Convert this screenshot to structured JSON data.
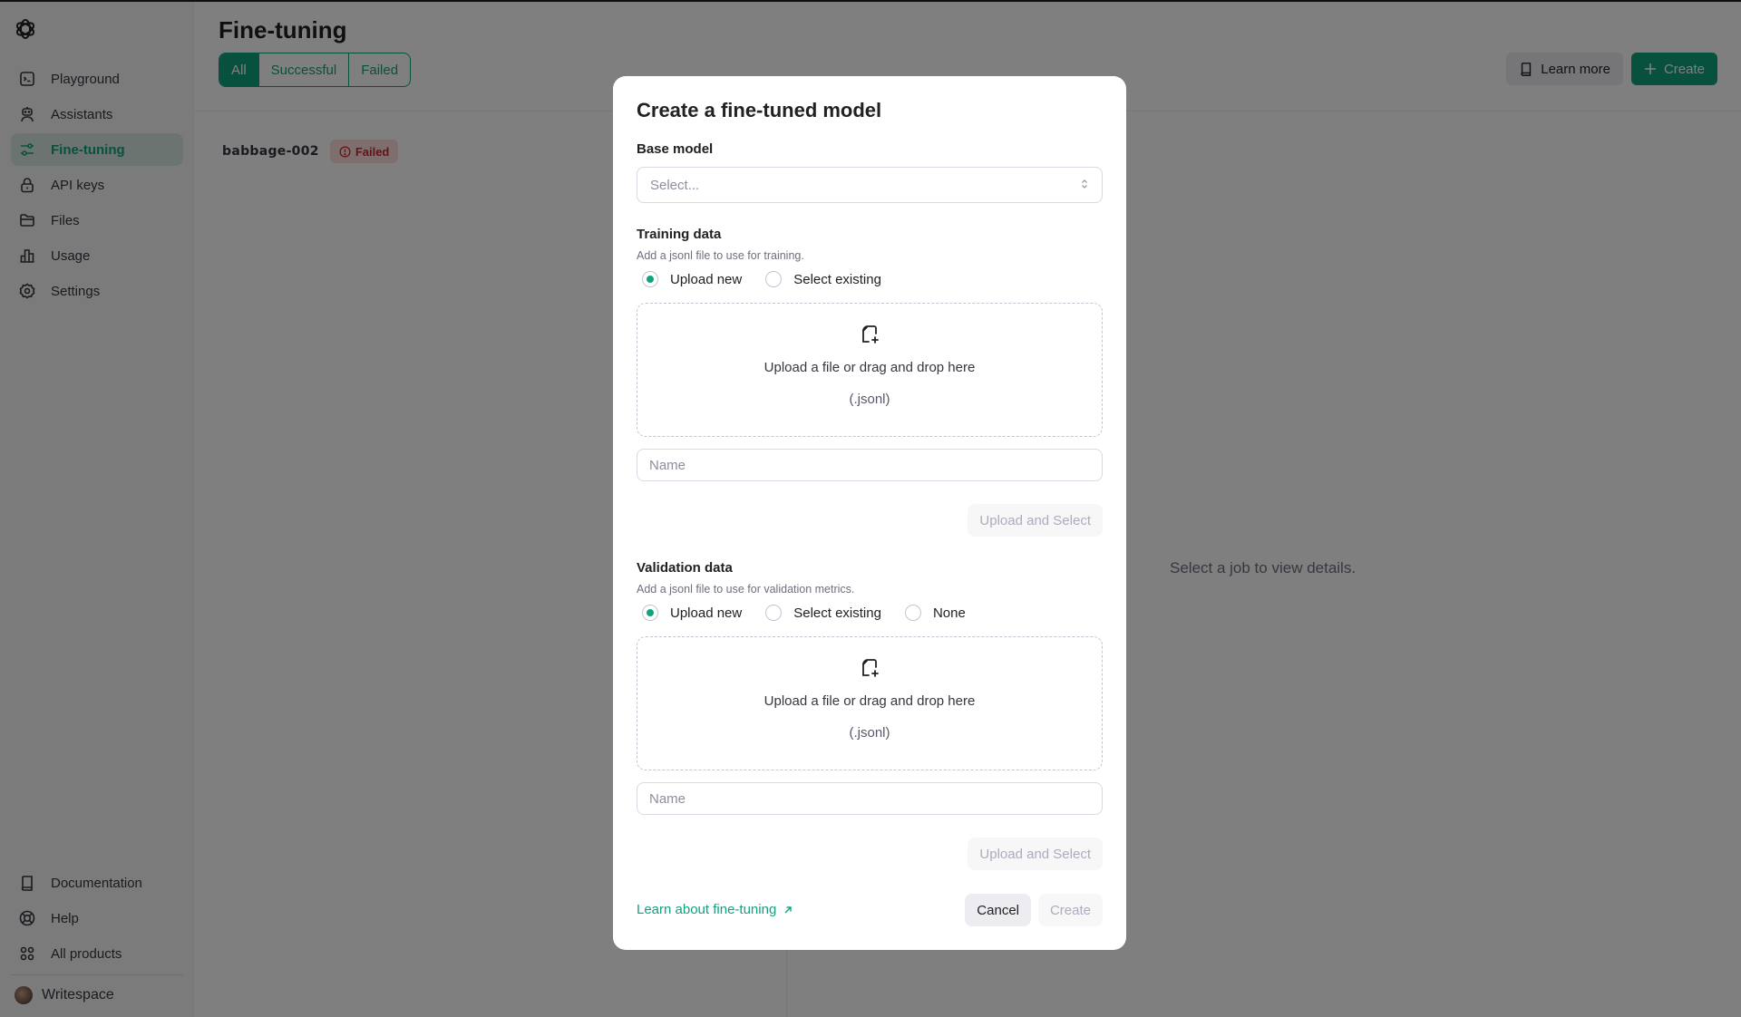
{
  "sidebar": {
    "logo": "openai-logo",
    "nav": [
      {
        "label": "Playground",
        "icon": "terminal-icon",
        "active": false
      },
      {
        "label": "Assistants",
        "icon": "robot-icon",
        "active": false
      },
      {
        "label": "Fine-tuning",
        "icon": "sliders-icon",
        "active": true
      },
      {
        "label": "API keys",
        "icon": "lock-icon",
        "active": false
      },
      {
        "label": "Files",
        "icon": "folder-icon",
        "active": false
      },
      {
        "label": "Usage",
        "icon": "bar-chart-icon",
        "active": false
      },
      {
        "label": "Settings",
        "icon": "gear-icon",
        "active": false
      }
    ],
    "bottom": [
      {
        "label": "Documentation",
        "icon": "book-icon"
      },
      {
        "label": "Help",
        "icon": "lifebuoy-icon"
      },
      {
        "label": "All products",
        "icon": "grid-icon"
      }
    ],
    "workspace": "Writespace"
  },
  "page": {
    "title": "Fine-tuning",
    "filters": [
      {
        "label": "All",
        "active": true
      },
      {
        "label": "Successful",
        "active": false
      },
      {
        "label": "Failed",
        "active": false
      }
    ],
    "learn_more": "Learn more",
    "create": "Create",
    "jobs": [
      {
        "name": "babbage-002",
        "status": "Failed"
      }
    ],
    "empty_detail": "Select a job to view details."
  },
  "modal": {
    "title": "Create a fine-tuned model",
    "base_model": {
      "label": "Base model",
      "placeholder": "Select..."
    },
    "training": {
      "label": "Training data",
      "help": "Add a jsonl file to use for training.",
      "options": [
        "Upload new",
        "Select existing"
      ],
      "selected": "Upload new",
      "drop_text": "Upload a file or drag and drop here",
      "drop_ext": "(.jsonl)",
      "name_placeholder": "Name",
      "name_value": "",
      "upload_button": "Upload and Select"
    },
    "validation": {
      "label": "Validation data",
      "help": "Add a jsonl file to use for validation metrics.",
      "options": [
        "Upload new",
        "Select existing",
        "None"
      ],
      "selected": "Upload new",
      "drop_text": "Upload a file or drag and drop here",
      "drop_ext": "(.jsonl)",
      "name_placeholder": "Name",
      "name_value": "",
      "upload_button": "Upload and Select"
    },
    "learn_link": "Learn about fine-tuning",
    "cancel": "Cancel",
    "create": "Create"
  },
  "colors": {
    "accent": "#10a37f",
    "danger": "#c62828",
    "overlay": "rgba(0,0,0,0.5)"
  }
}
